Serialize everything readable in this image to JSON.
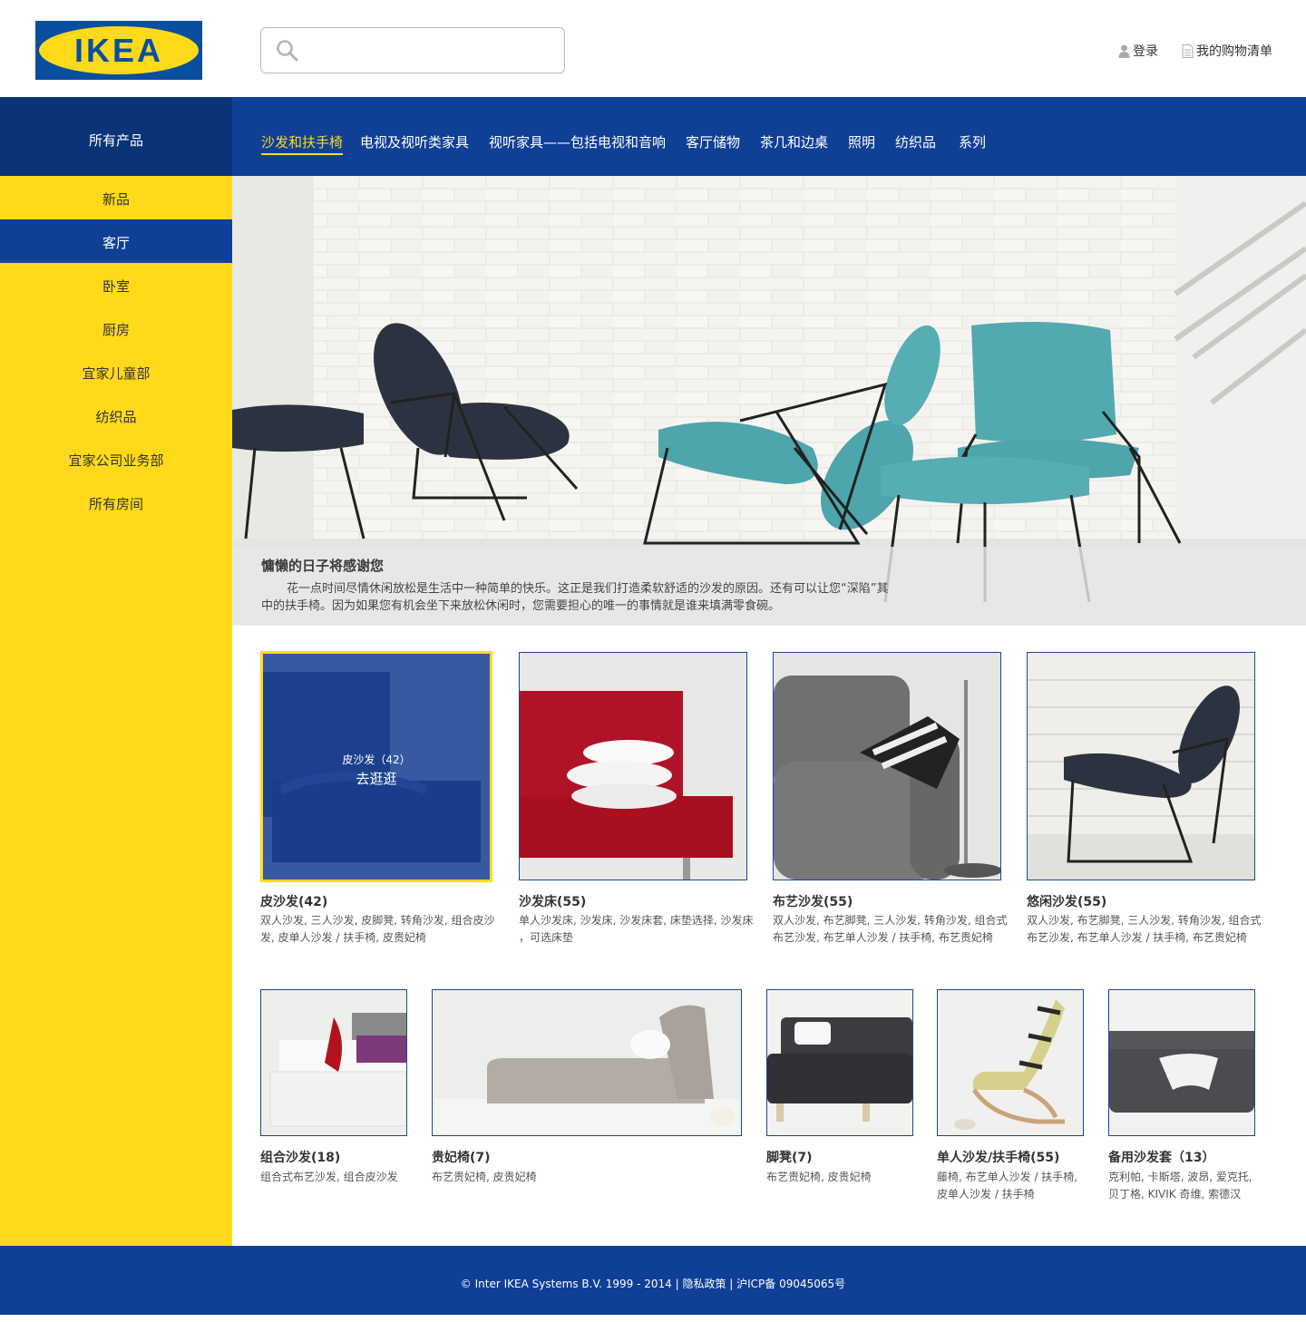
{
  "header": {
    "logo_text": "IKEA",
    "search_placeholder": "",
    "login_label": "登录",
    "cart_label": "我的购物清单"
  },
  "sidebar": {
    "title": "所有产品",
    "items": [
      {
        "label": "新品",
        "active": false
      },
      {
        "label": "客厅",
        "active": true
      },
      {
        "label": "卧室",
        "active": false
      },
      {
        "label": "厨房",
        "active": false
      },
      {
        "label": "宜家儿童部",
        "active": false
      },
      {
        "label": "纺织品",
        "active": false
      },
      {
        "label": "宜家公司业务部",
        "active": false
      },
      {
        "label": "所有房间",
        "active": false
      }
    ]
  },
  "topnav": {
    "items": [
      {
        "label": "沙发和扶手椅",
        "active": true
      },
      {
        "label": "电视及视听类家具",
        "active": false
      },
      {
        "label": "视听家具——包括电视和音响",
        "active": false
      },
      {
        "label": "客厅储物",
        "active": false
      },
      {
        "label": "茶几和边桌",
        "active": false
      },
      {
        "label": "照明",
        "active": false
      },
      {
        "label": "纺织品",
        "active": false
      },
      {
        "label": "系列",
        "active": false
      }
    ]
  },
  "hero": {
    "title": "慵懒的日子将感谢您",
    "description": "花一点时间尽情休闲放松是生活中一种简单的快乐。这正是我们打造柔软舒适的沙发的原因。还有可以让您“深陷”其中的扶手椅。因为如果您有机会坐下来放松休闲时，您需要担心的唯一的事情就是谁来填满零食碗。"
  },
  "overlay": {
    "small": "皮沙发（42）",
    "big": "去逛逛"
  },
  "products_row1": [
    {
      "title": "皮沙发(42)",
      "desc": "双人沙发, 三人沙发, 皮脚凳, 转角沙发, 组合皮沙发, 皮单人沙发 / 扶手椅, 皮贵妃椅"
    },
    {
      "title": "沙发床(55)",
      "desc": "单人沙发床, 沙发床, 沙发床套, 床垫选择, 沙发床 ，可选床垫"
    },
    {
      "title": "布艺沙发(55)",
      "desc": "双人沙发, 布艺脚凳, 三人沙发, 转角沙发, 组合式布艺沙发, 布艺单人沙发 / 扶手椅, 布艺贵妃椅"
    },
    {
      "title": "悠闲沙发(55)",
      "desc": "双人沙发, 布艺脚凳, 三人沙发, 转角沙发, 组合式布艺沙发, 布艺单人沙发 / 扶手椅, 布艺贵妃椅"
    }
  ],
  "products_row2": [
    {
      "title": "组合沙发(18)",
      "desc": "组合式布艺沙发, 组合皮沙发"
    },
    {
      "title": "贵妃椅(7)",
      "desc": "布艺贵妃椅, 皮贵妃椅"
    },
    {
      "title": "脚凳(7)",
      "desc": "布艺贵妃椅, 皮贵妃椅"
    },
    {
      "title": "单人沙发/扶手椅(55)",
      "desc": "藤椅, 布艺单人沙发 / 扶手椅, 皮单人沙发 / 扶手椅"
    },
    {
      "title": "备用沙发套（13）",
      "desc": "克利帕, 卡斯塔, 波昂, 爱克托, 贝丁格, KIVIK 奇维, 索德汉"
    }
  ],
  "footer": {
    "text": "© Inter IKEA Systems B.V. 1999 - 2014 | 隐私政策 | 沪ICP备 09045065号"
  },
  "colors": {
    "brand_blue": "#103f96",
    "brand_yellow": "#ffda1a",
    "dark_blue": "#0b3478"
  },
  "icons": [
    "search-icon",
    "user-icon",
    "list-icon"
  ]
}
